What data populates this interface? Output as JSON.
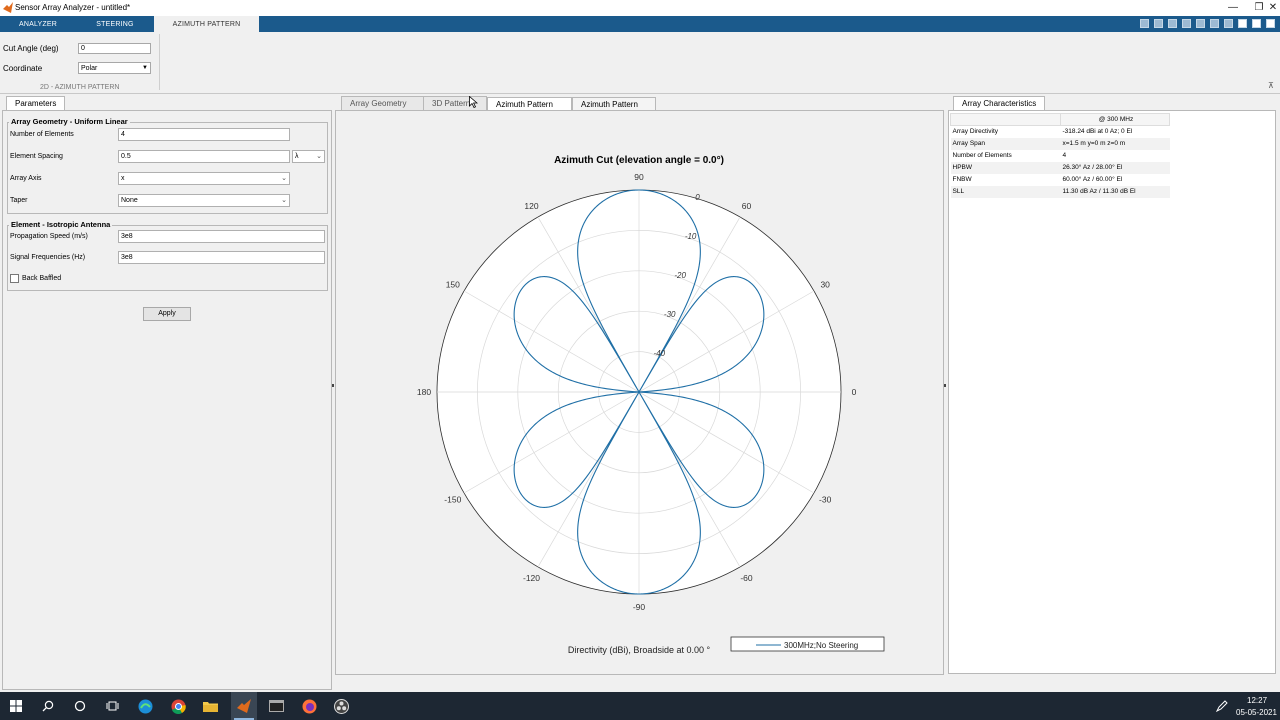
{
  "window": {
    "title": "Sensor Array Analyzer - untitled*",
    "controls": [
      "—",
      "❐",
      "✕"
    ]
  },
  "ribbon": {
    "tabs": [
      "ANALYZER",
      "STEERING",
      "AZIMUTH PATTERN"
    ],
    "active_tab": "AZIMUTH PATTERN"
  },
  "toolstrip": {
    "cut_angle_label": "Cut Angle (deg)",
    "cut_angle_value": "0",
    "coordinate_label": "Coordinate",
    "coordinate_value": "Polar",
    "section_label": "2D - AZIMUTH PATTERN"
  },
  "parameters": {
    "tab": "Parameters",
    "geometry_title": "Array Geometry - Uniform Linear",
    "num_elements_label": "Number of Elements",
    "num_elements_value": "4",
    "element_spacing_label": "Element Spacing",
    "element_spacing_value": "0.5",
    "element_spacing_unit": "λ",
    "array_axis_label": "Array Axis",
    "array_axis_value": "x",
    "taper_label": "Taper",
    "taper_value": "None",
    "element_title": "Element - Isotropic Antenna",
    "prop_speed_label": "Propagation Speed (m/s)",
    "prop_speed_value": "3e8",
    "signal_freq_label": "Signal Frequencies (Hz)",
    "signal_freq_value": "3e8",
    "back_baffled_label": "Back Baffled",
    "apply_label": "Apply"
  },
  "plot_tabs": [
    "Array Geometry",
    "3D Pattern",
    "Azimuth Pattern",
    "Azimuth Pattern"
  ],
  "plot_active_tab": 2,
  "chart_data": {
    "type": "polar",
    "title": "Azimuth Cut (elevation angle = 0.0°)",
    "xlabel": "Directivity (dBi), Broadside at 0.00 °",
    "angle_ticks": [
      "90",
      "60",
      "30",
      "0",
      "-30",
      "-60",
      "-90",
      "-120",
      "-150",
      "180",
      "150",
      "120"
    ],
    "radial_ticks": [
      "0",
      "-10",
      "-20",
      "-30",
      "-40"
    ],
    "radial_range": [
      -50,
      0
    ],
    "grid": true,
    "legend_position": "bottom-right",
    "series": [
      {
        "name": "300MHz;No Steering",
        "color": "#1f6fa6",
        "model": "uniform linear array, N=4, spacing 0.5λ, array axis x"
      }
    ]
  },
  "characteristics": {
    "tab": "Array Characteristics",
    "column_header": "@ 300 MHz",
    "rows": [
      [
        "Array Directivity",
        "-318.24 dBi at 0 Az; 0 El"
      ],
      [
        "Array Span",
        "x=1.5 m y=0 m z=0 m"
      ],
      [
        "Number of Elements",
        "4"
      ],
      [
        "HPBW",
        "26.30° Az / 28.00° El"
      ],
      [
        "FNBW",
        "60.00° Az / 60.00° El"
      ],
      [
        "SLL",
        "11.30 dB Az / 11.30 dB El"
      ]
    ]
  },
  "taskbar": {
    "time": "12:27",
    "date": "05-05-2021"
  }
}
